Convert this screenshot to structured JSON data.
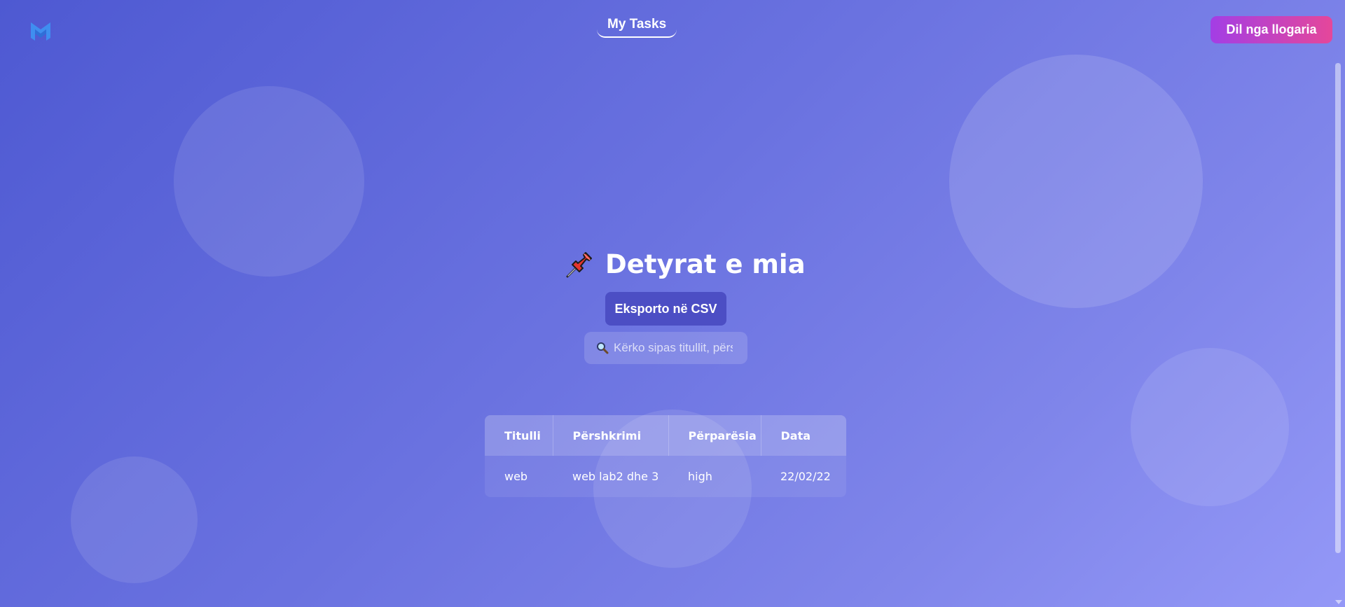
{
  "header": {
    "logo_icon": "m-logo-icon",
    "nav_link_label": "My Tasks",
    "logout_label": "Dil nga llogaria"
  },
  "main": {
    "title_icon": "pushpin-icon",
    "title": "Detyrat e mia",
    "export_label": "Eksporto në CSV",
    "search": {
      "icon": "magnifier-icon",
      "placeholder": "Kërko sipas titullit, përshkrimit...",
      "value": ""
    }
  },
  "tasks_table": {
    "columns": [
      "Titulli",
      "Përshkrimi",
      "Përparësia",
      "Data"
    ],
    "rows": [
      [
        "web",
        "web lab2 dhe 3",
        "high",
        "22/02/22"
      ]
    ]
  },
  "colors": {
    "background_start": "#4e59d2",
    "background_end": "#9498f7",
    "export_button": "#4c4ec4",
    "logout_gradient_start": "#a33ee5",
    "logout_gradient_end": "#e5479a",
    "logo": "#3f8ef0"
  }
}
